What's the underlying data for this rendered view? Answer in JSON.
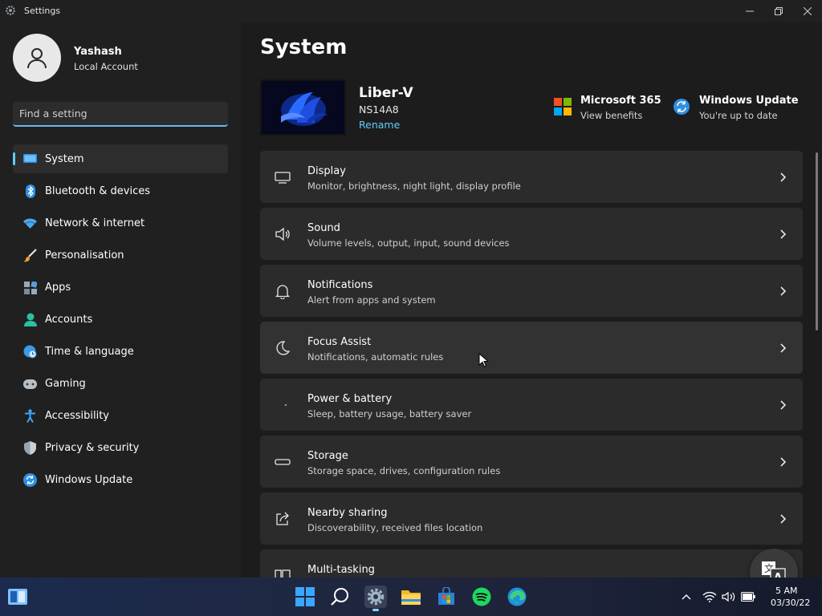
{
  "window": {
    "title": "Settings",
    "icons": {
      "app": "gear-icon",
      "minimize": "minimize-icon",
      "maximize": "restore-icon",
      "close": "close-icon"
    }
  },
  "sidebar": {
    "user": {
      "name": "Yashash",
      "account_type": "Local Account",
      "avatar_icon": "person-icon"
    },
    "search": {
      "placeholder": "Find a setting"
    },
    "items": [
      {
        "label": "System",
        "icon": "display-icon",
        "active": true
      },
      {
        "label": "Bluetooth & devices",
        "icon": "bluetooth-icon"
      },
      {
        "label": "Network & internet",
        "icon": "wifi-icon"
      },
      {
        "label": "Personalisation",
        "icon": "brush-icon"
      },
      {
        "label": "Apps",
        "icon": "apps-icon"
      },
      {
        "label": "Accounts",
        "icon": "person-icon"
      },
      {
        "label": "Time & language",
        "icon": "globe-clock-icon"
      },
      {
        "label": "Gaming",
        "icon": "gamepad-icon"
      },
      {
        "label": "Accessibility",
        "icon": "accessibility-icon"
      },
      {
        "label": "Privacy & security",
        "icon": "shield-icon"
      },
      {
        "label": "Windows Update",
        "icon": "update-icon"
      }
    ]
  },
  "main": {
    "title": "System",
    "device": {
      "name": "Liber-V",
      "model": "NS14A8",
      "rename_label": "Rename"
    },
    "promos": [
      {
        "title": "Microsoft 365",
        "subtitle": "View benefits",
        "icon": "microsoft-logo-icon"
      },
      {
        "title": "Windows Update",
        "subtitle": "You're up to date",
        "icon": "update-icon"
      }
    ],
    "cards": [
      {
        "title": "Display",
        "subtitle": "Monitor, brightness, night light, display profile",
        "icon": "monitor-icon"
      },
      {
        "title": "Sound",
        "subtitle": "Volume levels, output, input, sound devices",
        "icon": "speaker-icon"
      },
      {
        "title": "Notifications",
        "subtitle": "Alert from apps and system",
        "icon": "bell-icon"
      },
      {
        "title": "Focus Assist",
        "subtitle": "Notifications, automatic rules",
        "icon": "moon-icon"
      },
      {
        "title": "Power & battery",
        "subtitle": "Sleep, battery usage, battery saver",
        "icon": "power-icon"
      },
      {
        "title": "Storage",
        "subtitle": "Storage space, drives, configuration rules",
        "icon": "storage-icon"
      },
      {
        "title": "Nearby sharing",
        "subtitle": "Discoverability, received files location",
        "icon": "share-icon"
      },
      {
        "title": "Multi-tasking",
        "subtitle": "",
        "icon": "multitask-icon"
      }
    ]
  },
  "taskbar": {
    "apps": [
      "widgets-icon",
      "start-icon",
      "search-icon",
      "settings-icon",
      "file-explorer-icon",
      "store-icon",
      "spotify-icon",
      "edge-icon"
    ],
    "tray": [
      "chevron-up-icon",
      "wifi-icon",
      "volume-icon",
      "battery-icon"
    ],
    "clock": {
      "time": "5 AM",
      "date": "03/30/22"
    },
    "ime_icon": "translate-icon"
  },
  "colors": {
    "accent": "#60cdff",
    "background": "#1c1c1c",
    "card": "#2b2b2b",
    "sidebar": "#202020"
  }
}
